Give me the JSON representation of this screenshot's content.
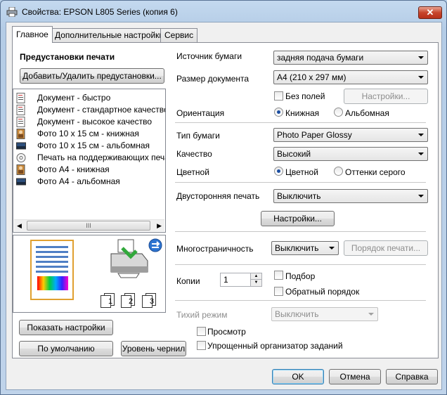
{
  "window": {
    "title": "Свойства: EPSON L805 Series (копия 6)",
    "close_glyph": "✕"
  },
  "tabs": [
    {
      "label": "Главное"
    },
    {
      "label": "Дополнительные настройки"
    },
    {
      "label": "Сервис"
    }
  ],
  "presets": {
    "heading": "Предустановки печати",
    "add_remove_button": "Добавить/Удалить предустановки...",
    "items": [
      {
        "label": "Документ - быстро",
        "icon": "document-icon"
      },
      {
        "label": "Документ - стандартное качество",
        "icon": "document-icon"
      },
      {
        "label": "Документ - высокое качество",
        "icon": "document-icon"
      },
      {
        "label": "Фото 10 x 15 см - книжная",
        "icon": "photo-portrait-icon"
      },
      {
        "label": "Фото 10 x 15 см - альбомная",
        "icon": "photo-landscape-icon"
      },
      {
        "label": "Печать на поддерживающих печат",
        "icon": "disc-icon"
      },
      {
        "label": "Фото А4 - книжная",
        "icon": "photo-portrait-icon"
      },
      {
        "label": "Фото А4 - альбомная",
        "icon": "photo-landscape-icon"
      }
    ],
    "scroll_thumb": "III"
  },
  "preview": {
    "page_numbers": [
      "1",
      "2",
      "3"
    ]
  },
  "left_buttons": {
    "show_settings": "Показать настройки",
    "defaults": "По умолчанию",
    "ink_level": "Уровень чернил"
  },
  "settings": {
    "paper_source": {
      "label": "Источник бумаги",
      "value": "задняя подача бумаги"
    },
    "document_size": {
      "label": "Размер документа",
      "value": "А4 (210 x 297 мм)"
    },
    "borderless": {
      "label": "Без полей",
      "checked": false,
      "button": "Настройки..."
    },
    "orientation": {
      "label": "Ориентация",
      "options": [
        "Книжная",
        "Альбомная"
      ],
      "selected": "Книжная"
    },
    "paper_type": {
      "label": "Тип бумаги",
      "value": "Photo Paper Glossy"
    },
    "quality": {
      "label": "Качество",
      "value": "Высокий"
    },
    "color": {
      "label": "Цветной",
      "options": [
        "Цветной",
        "Оттенки серого"
      ],
      "selected": "Цветной"
    },
    "duplex": {
      "label": "Двусторонняя печать",
      "value": "Выключить",
      "button": "Настройки..."
    },
    "multipage": {
      "label": "Многостраничность",
      "value": "Выключить",
      "button": "Порядок печати..."
    },
    "copies": {
      "label": "Копии",
      "value": "1"
    },
    "collate": {
      "label": "Подбор",
      "checked": false
    },
    "reverse": {
      "label": "Обратный порядок",
      "checked": false
    },
    "quiet_mode": {
      "label": "Тихий режим",
      "value": "Выключить"
    },
    "preview": {
      "label": "Просмотр",
      "checked": false
    },
    "job_arranger": {
      "label": "Упрощенный организатор заданий",
      "checked": false
    }
  },
  "dialog_buttons": {
    "ok": "OK",
    "cancel": "Отмена",
    "help": "Справка"
  }
}
